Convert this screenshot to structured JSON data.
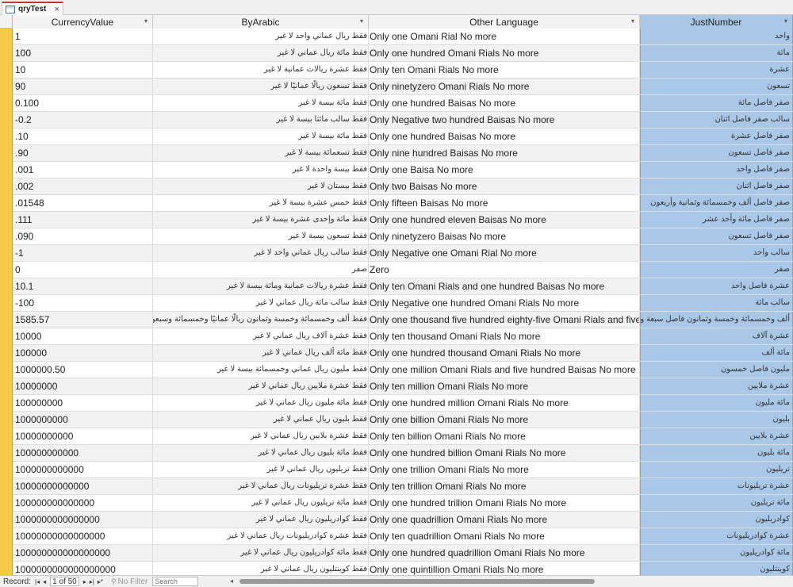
{
  "tab": {
    "title": "qryTest",
    "close": "×"
  },
  "columns": [
    "CurrencyValue",
    "ByArabic",
    "Other Language",
    "JustNumber"
  ],
  "rows": [
    {
      "currency": "1",
      "arabic": "فقط ريال عماني واحد لا غير",
      "other": "Only one Omani Rial No more",
      "just": "واحد"
    },
    {
      "currency": "100",
      "arabic": "فقط مائة ريال عماني لا غير",
      "other": "Only one hundred Omani Rials No more",
      "just": "مائة"
    },
    {
      "currency": "10",
      "arabic": "فقط عشرة ريالات عمانية لا غير",
      "other": "Only ten Omani Rials No more",
      "just": "عشرة"
    },
    {
      "currency": "90",
      "arabic": "فقط تسعون ريالًا عمانيًا لا غير",
      "other": "Only ninetyzero Omani Rials No more",
      "just": "تسعون"
    },
    {
      "currency": "0.100",
      "arabic": "فقط مائة بيسة لا غير",
      "other": "Only one hundred Baisas No more",
      "just": "صفر فاصل مائة"
    },
    {
      "currency": "-0.2",
      "arabic": "فقط سالب مائتا بيسة لا غير",
      "other": "Only Negative two hundred Baisas No more",
      "just": "سالب صفر فاصل اثنان"
    },
    {
      "currency": ".10",
      "arabic": "فقط مائة بيسة لا غير",
      "other": "Only one hundred Baisas No more",
      "just": "صفر فاصل عشرة"
    },
    {
      "currency": ".90",
      "arabic": "فقط تسعمائة بيسة لا غير",
      "other": "Only nine hundred Baisas No more",
      "just": "صفر فاصل تسعون"
    },
    {
      "currency": ".001",
      "arabic": "فقط بيسة واحدة لا غير",
      "other": "Only one Baisa No more",
      "just": "صفر فاصل واحد"
    },
    {
      "currency": ".002",
      "arabic": "فقط بيستان لا غير",
      "other": "Only two Baisas No more",
      "just": "صفر فاصل اثنان"
    },
    {
      "currency": ".01548",
      "arabic": "فقط خمس عشرة بيسة لا غير",
      "other": "Only fifteen Baisas No more",
      "just": "صفر فاصل ألف وخمسمائة وثمانية وأربعون"
    },
    {
      "currency": ".111",
      "arabic": "فقط مائة وإحدى عشرة بيسة لا غير",
      "other": "Only one hundred eleven Baisas No more",
      "just": "صفر فاصل مائة وأحد عشر"
    },
    {
      "currency": ".090",
      "arabic": "فقط تسعون بيسة لا غير",
      "other": "Only ninetyzero Baisas No more",
      "just": "صفر فاصل تسعون"
    },
    {
      "currency": "-1",
      "arabic": "فقط سالب ريال عماني واحد لا غير",
      "other": "Only Negative one Omani Rial No more",
      "just": "سالب واحد"
    },
    {
      "currency": "0",
      "arabic": "صفر",
      "other": "Zero",
      "just": "صفر"
    },
    {
      "currency": "10.1",
      "arabic": "فقط عشرة ريالات عمانية ومائة بيسة لا غير",
      "other": "Only ten Omani Rials and one hundred Baisas No more",
      "just": "عشرة فاصل واحد"
    },
    {
      "currency": "-100",
      "arabic": "فقط سالب مائة ريال عماني لا غير",
      "other": "Only Negative one hundred Omani Rials No more",
      "just": "سالب مائة"
    },
    {
      "currency": "1585.57",
      "arabic": "فقط ألف وخمسمائة وخمسة وثمانون ريالًا عمانيًا وخمسمائة وسبعون",
      "other": "Only one thousand five hundred eighty-five Omani Rials and five",
      "just": "ألف وخمسمائة وخمسة وثمانون فاصل سبعة وخمسون"
    },
    {
      "currency": "10000",
      "arabic": "فقط عشرة آلاف ريال عماني لا غير",
      "other": "Only ten thousand Omani Rials No more",
      "just": "عشرة آلاف"
    },
    {
      "currency": "100000",
      "arabic": "فقط مائة ألف ريال عماني لا غير",
      "other": "Only one hundred thousand Omani Rials No more",
      "just": "مائة ألف"
    },
    {
      "currency": "1000000.50",
      "arabic": "فقط مليون ريال عماني وخمسمائة بيسة لا غير",
      "other": "Only one million Omani Rials and five hundred Baisas No more",
      "just": "مليون فاصل خمسون"
    },
    {
      "currency": "10000000",
      "arabic": "فقط عشرة ملايين ريال عماني لا غير",
      "other": "Only ten million Omani Rials No more",
      "just": "عشرة ملايين"
    },
    {
      "currency": "100000000",
      "arabic": "فقط مائة مليون ريال عماني لا غير",
      "other": "Only one hundred million Omani Rials No more",
      "just": "مائة مليون"
    },
    {
      "currency": "1000000000",
      "arabic": "فقط بليون ريال عماني لا غير",
      "other": "Only one billion Omani Rials No more",
      "just": "بليون"
    },
    {
      "currency": "10000000000",
      "arabic": "فقط عشرة بلايين ريال عماني لا غير",
      "other": "Only ten billion Omani Rials No more",
      "just": "عشرة بلايين"
    },
    {
      "currency": "100000000000",
      "arabic": "فقط مائة بليون ريال عماني لا غير",
      "other": "Only one hundred billion Omani Rials No more",
      "just": "مائة بليون"
    },
    {
      "currency": "1000000000000",
      "arabic": "فقط تريليون ريال عماني لا غير",
      "other": "Only one trillion Omani Rials No more",
      "just": "تريليون"
    },
    {
      "currency": "10000000000000",
      "arabic": "فقط عشرة تريليونات ريال عماني لا غير",
      "other": "Only ten trillion Omani Rials No more",
      "just": "عشرة تريليونات"
    },
    {
      "currency": "100000000000000",
      "arabic": "فقط مائة تريليون ريال عماني لا غير",
      "other": "Only one hundred trillion Omani Rials No more",
      "just": "مائة تريليون"
    },
    {
      "currency": "1000000000000000",
      "arabic": "فقط كوادريليون ريال عماني لا غير",
      "other": "Only one quadrillion Omani Rials No more",
      "just": "كوادريليون"
    },
    {
      "currency": "10000000000000000",
      "arabic": "فقط عشرة كوادريليونات ريال عماني لا غير",
      "other": "Only ten quadrillion Omani Rials No more",
      "just": "عشرة كوادريليونات"
    },
    {
      "currency": "100000000000000000",
      "arabic": "فقط مائة كوادريليون ريال عماني لا غير",
      "other": "Only one hundred quadrillion Omani Rials No more",
      "just": "مائة كوادريليون"
    },
    {
      "currency": "1000000000000000000",
      "arabic": "فقط كوينتليون ريال عماني لا غير",
      "other": "Only one quintillion Omani Rials No more",
      "just": "كوينتليون"
    }
  ],
  "nav": {
    "record_label": "Record:",
    "first": "|◂",
    "prev": "◂",
    "position": "1 of 50",
    "next": "▸",
    "last": "▸|",
    "new": "▸*",
    "filter_label": "No Filter",
    "search_placeholder": "Search"
  },
  "colors": {
    "selector": "#f7c948",
    "selected_column": "#a9c8e8",
    "tab_accent": "#c0392b"
  },
  "icons": {
    "tab": "table-query-icon",
    "filter": "funnel-icon"
  }
}
